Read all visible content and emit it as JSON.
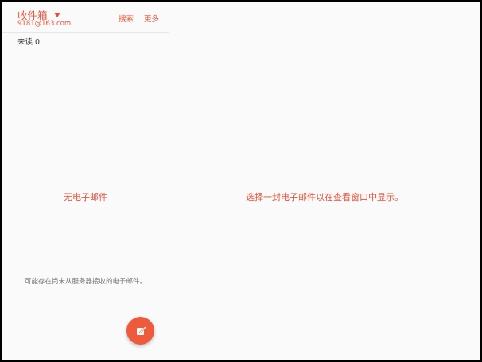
{
  "header": {
    "folder_name": "收件箱",
    "account_email": "    9181@163.com",
    "search_label": "搜索",
    "more_label": "更多"
  },
  "mail_list": {
    "unread_label": "未读 0",
    "empty_title": "无电子邮件",
    "empty_hint": "可能存在尚未从服务器接收的电子邮件。"
  },
  "viewer": {
    "empty_hint": "选择一封电子邮件以在查看窗口中显示。"
  },
  "compose_button": {
    "icon": "compose-icon"
  },
  "colors": {
    "accent": "#e4523b",
    "fab": "#ef5a3c",
    "background": "#fafafa",
    "divider": "#e2e2e2"
  }
}
